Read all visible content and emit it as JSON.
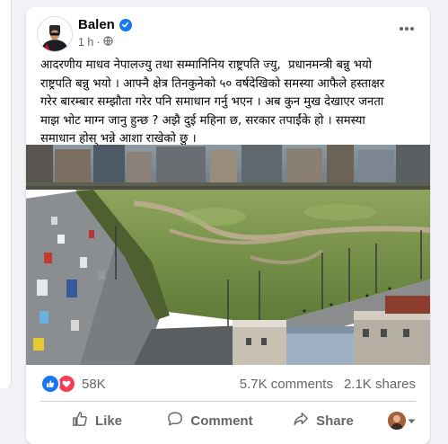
{
  "post": {
    "author": "Balen",
    "time": "1 h",
    "separator": "·",
    "caption": "आदरणीय माधव नेपालज्यु तथा सम्मानिनिय राष्ट्रपति ज्यु,  प्रधानमन्त्री बन्नु भयो\nराष्ट्रपति बन्नु भयो । आफ्नै क्षेत्र तिनकुनेको ५० वर्षदेखिको समस्या आफैले हस्ताक्षर\nगरेर बारम्बार सम्झौता गरेर पनि समाधान गर्नु भएन । अब कुन मुख देखाएर जनता\nमाझ भोट माग्न जानु हुन्छ ? अझै दुई महिना छ, सरकार तपाईंके हो । समस्या\nसमाधान होस् भन्ने आशा राखेको छु ।"
  },
  "reactions": {
    "count": "58K",
    "comments": "5.7K comments",
    "shares": "2.1K shares"
  },
  "actions": {
    "like": "Like",
    "comment": "Comment",
    "share": "Share"
  },
  "icons": {
    "verified": "verified-badge-icon",
    "globe": "globe-icon",
    "more": "more-options-icon",
    "like": "thumbs-up-icon",
    "love": "heart-icon",
    "comment": "comment-bubble-icon",
    "share": "share-arrow-icon",
    "dropdown": "caret-down-icon"
  },
  "colors": {
    "brand_blue": "#1877f2",
    "love_red": "#f33e58",
    "secondary_text": "#65676b"
  }
}
